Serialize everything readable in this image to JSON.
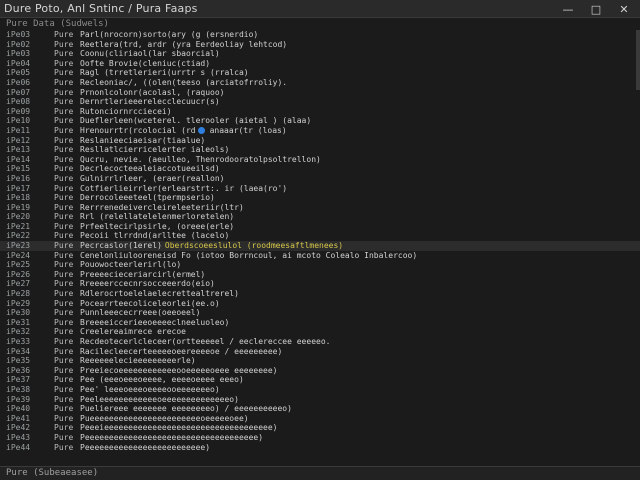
{
  "window": {
    "title": "Dure Poto, Anl Sntinc / Pura Faaps",
    "minimize_icon": "minimize-icon",
    "maximize_icon": "maximize-icon",
    "close_icon": "close-icon"
  },
  "header": {
    "text": "Pure Data (Sudwels)"
  },
  "rows": [
    {
      "id": "iPe03",
      "kind": "Pure",
      "text": "Parl(nrocorn)sorto(ary (g (ersnerdio)"
    },
    {
      "id": "iPe02",
      "kind": "Pure",
      "text": "Reetlera(trd, ardr (yra Eerdeoliay lehtcod)"
    },
    {
      "id": "iPe03",
      "kind": "Pure",
      "text": "Coonu(cliriaol(lar sbaorcial)"
    },
    {
      "id": "iPe04",
      "kind": "Pure",
      "text": "Oofte Brovie(cleniuc(ctiad)"
    },
    {
      "id": "iPe05",
      "kind": "Pure",
      "text": "Ragl (trretlerieri(urrtr s (rralca)"
    },
    {
      "id": "iPe06",
      "kind": "Pure",
      "text": "Recleoniac/, ((olen(teeso (arciatofrroliy)."
    },
    {
      "id": "iPe07",
      "kind": "Pure",
      "text": "Prnonlcolonr(acolasl, (raquoo)"
    },
    {
      "id": "iPe08",
      "kind": "Pure",
      "text": "Dernrtlerieeerelecclecuucr(s)"
    },
    {
      "id": "iPe09",
      "kind": "Pure",
      "text": "Rutonciornrcciecei)"
    },
    {
      "id": "iPe10",
      "kind": "Pure",
      "text": "Dueflerleen(wceterel. tlerooler (aietal ) (alaa)"
    },
    {
      "id": "iPe11",
      "kind": "Pure",
      "text": "Hrenourrtr(rcolocial (rd",
      "dot": true,
      "text2": "anaaar(tr (loas)"
    },
    {
      "id": "iPe12",
      "kind": "Pure",
      "text": "Reslanieeciaeisar(tiaalue)"
    },
    {
      "id": "iPe13",
      "kind": "Pure",
      "text": "Resllatlcierricelerter ialeols)"
    },
    {
      "id": "iPe14",
      "kind": "Pure",
      "text": "Qucru, nevie. (aeulleo, Thenrodooratolpsoltrellon)"
    },
    {
      "id": "iPe15",
      "kind": "Pure",
      "text": "Decrlecocteealeiaccotueeilsd)"
    },
    {
      "id": "iPe16",
      "kind": "Pure",
      "text": "Gulnirrlrleer, (eraer(reallon)"
    },
    {
      "id": "iPe17",
      "kind": "Pure",
      "text": "Cotfierlieirrler(erlearstrt:. ir (laea(ro')"
    },
    {
      "id": "iPe18",
      "kind": "Pure",
      "text": "Derrocoleeeteel(tpermpserio)"
    },
    {
      "id": "iPe19",
      "kind": "Pure",
      "text": "Rerrrenedeivercleireleeteriir(ltr)"
    },
    {
      "id": "iPe20",
      "kind": "Pure",
      "text": "Rrl (relellatelelenmerloretelen)"
    },
    {
      "id": "iPe21",
      "kind": "Pure",
      "text": "Prfeeltecirlpsirle, (oreee(erle)"
    },
    {
      "id": "iPe22",
      "kind": "Pure",
      "text": "Pecoii tlrrdnd(arlltee (lacelo)"
    },
    {
      "id": "iPe23",
      "kind": "Pure",
      "text": "Pecrcaslor(1erel)",
      "text2": "Oberdscoeeslulol (roodmeesaftlmenees)",
      "highlight": true
    },
    {
      "id": "iPe24",
      "kind": "Pure",
      "text": "Cenelonliulooreneisd Fo (iotoo Borrncoul, ai mcoto Colealo Inbalercoo)"
    },
    {
      "id": "iPe25",
      "kind": "Pure",
      "text": "Pouowocteerlerirl(lo)"
    },
    {
      "id": "iPe26",
      "kind": "Pure",
      "text": "Preeeecieceriarcirl(ermel)"
    },
    {
      "id": "iPe27",
      "kind": "Pure",
      "text": "Rreeeerccecnrsocceeerdo(eio)"
    },
    {
      "id": "iPe28",
      "kind": "Pure",
      "text": "Rdlerocrtoelelaelecrettealtrerel)"
    },
    {
      "id": "iPe29",
      "kind": "Pure",
      "text": "Pocearrteecoliceleorlei(ee.o)"
    },
    {
      "id": "iPe30",
      "kind": "Pure",
      "text": "Punnleeececrreee(oeeoeel)"
    },
    {
      "id": "iPe31",
      "kind": "Pure",
      "text": "Breeeeiccerieeoeeeeclneeluoleo)"
    },
    {
      "id": "iPe32",
      "kind": "Pure",
      "text": "Creelereaimrece erecoe"
    },
    {
      "id": "iPe33",
      "kind": "Pure",
      "text": "Recdeotecerlcleceer(ortteeeeel / eeclereccee eeeeeo."
    },
    {
      "id": "iPe34",
      "kind": "Pure",
      "text": "Racilecleecerteeeeeoeereeeeoe / eeeeeeeee)"
    },
    {
      "id": "iPe35",
      "kind": "Pure",
      "text": "Reeeeeelecieeeeeeeeerle)"
    },
    {
      "id": "iPe36",
      "kind": "Pure",
      "text": "Preeiecoeeeeeeeeeeeeooeeeeeoeee eeeeeeee)"
    },
    {
      "id": "iPe37",
      "kind": "Pure",
      "text": "Pee (eeeoeeeoeeee, eeeeoeeee eeeo)"
    },
    {
      "id": "iPe38",
      "kind": "Pure",
      "text": "Pee' leeeoeeeoeeeeooeeeeeeeo)"
    },
    {
      "id": "iPe39",
      "kind": "Pure",
      "text": "Peeleeeeeeeeeeeeoeeeeeeeeeeeeeeo)"
    },
    {
      "id": "iPe40",
      "kind": "Pure",
      "text": "Pueliereee eeeeeee eeeeeeeeo) / eeeeeeeeeeo)"
    },
    {
      "id": "iPe41",
      "kind": "Pure",
      "text": "Pueeeeeeeeeeeeeeeeeeeeeeeoeeeeeoee)"
    },
    {
      "id": "iPe42",
      "kind": "Pure",
      "text": "Peeeieeeeeeeeeeeeeeeeeeeeeeeeeeeeeeeeeee)"
    },
    {
      "id": "iPe43",
      "kind": "Pure",
      "text": "Peeeeeeeeeeeeeeeeeeeeeeeeeeeeeeeeeeee)"
    },
    {
      "id": "iPe44",
      "kind": "Pure",
      "text": "Peeeeeeeeeeeeeeeeeeeeeeeee)"
    }
  ],
  "status": {
    "text": "Pure (Subeaeasee)"
  }
}
